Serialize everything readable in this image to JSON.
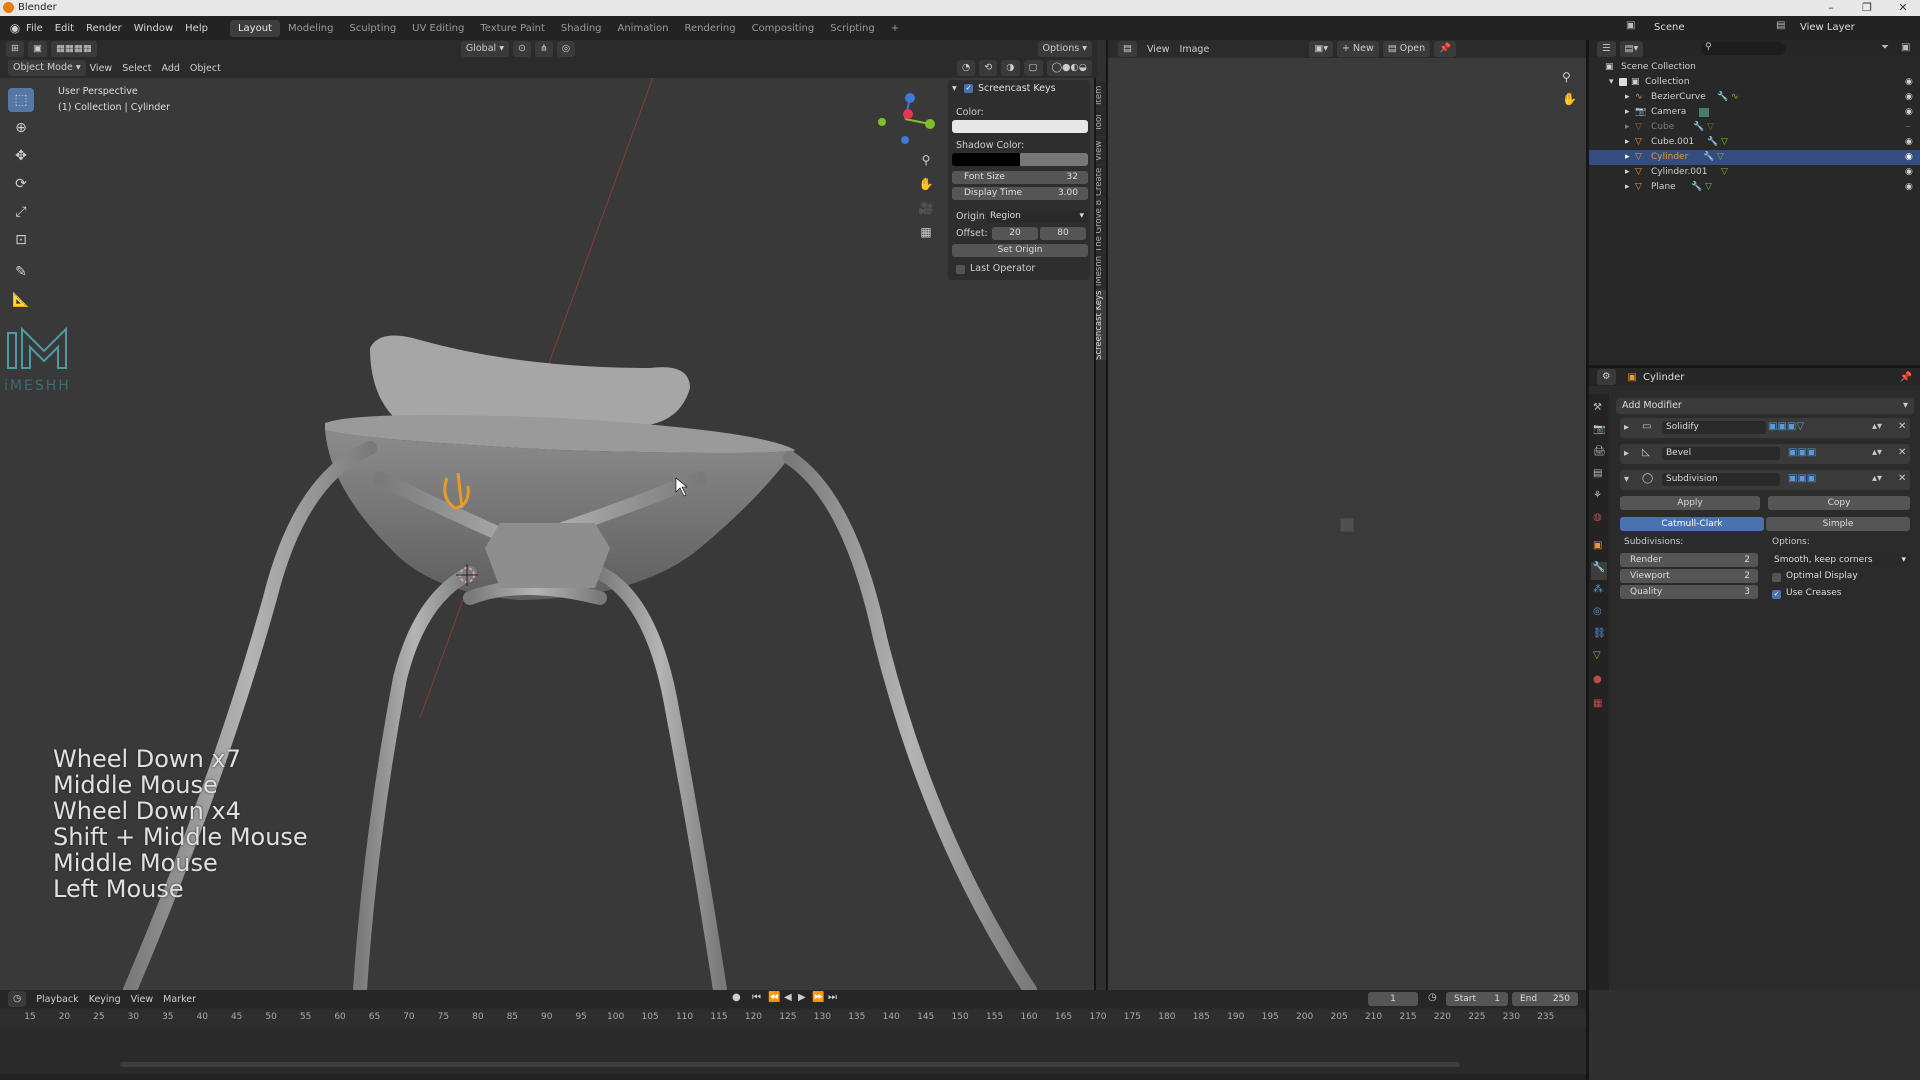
{
  "app": {
    "title": "Blender"
  },
  "menubar": {
    "items": [
      "File",
      "Edit",
      "Render",
      "Window",
      "Help"
    ],
    "workspaces": [
      "Layout",
      "Modeling",
      "Sculpting",
      "UV Editing",
      "Texture Paint",
      "Shading",
      "Animation",
      "Rendering",
      "Compositing",
      "Scripting"
    ],
    "active_workspace": "Layout",
    "scene_label": "Scene",
    "viewlayer_label": "View Layer"
  },
  "viewport_header": {
    "transform_orientation": "Global",
    "options_label": "Options",
    "mode": "Object Mode",
    "menus": [
      "View",
      "Select",
      "Add",
      "Object"
    ]
  },
  "viewport": {
    "perspective_label": "User Perspective",
    "collection_label": "(1) Collection | Cylinder",
    "logo_text": "iMESHH"
  },
  "npanel": {
    "header": "Screencast Keys",
    "color_label": "Color:",
    "shadow_color_label": "Shadow Color:",
    "font_size_label": "Font Size",
    "font_size_value": "32",
    "display_time_label": "Display Time",
    "display_time_value": "3.00",
    "origin_label": "Origin:",
    "origin_value": "Region",
    "offset_label": "Offset:",
    "offset_x": "20",
    "offset_y": "80",
    "set_origin_label": "Set Origin",
    "last_operator_label": "Last Operator",
    "tabs": [
      "Item",
      "Tool",
      "View",
      "Create",
      "The Grove 8",
      "iMeshh",
      "Screencast Keys"
    ]
  },
  "image_editor": {
    "menus": [
      "View",
      "Image"
    ],
    "new_label": "New",
    "open_label": "Open"
  },
  "outliner": {
    "root": "Scene Collection",
    "collection": "Collection",
    "items": [
      {
        "name": "BezierCurve"
      },
      {
        "name": "Camera"
      },
      {
        "name": "Cube"
      },
      {
        "name": "Cube.001"
      },
      {
        "name": "Cylinder"
      },
      {
        "name": "Cylinder.001"
      },
      {
        "name": "Plane"
      }
    ],
    "selected": "Cylinder"
  },
  "properties": {
    "object_name": "Cylinder",
    "add_modifier_label": "Add Modifier",
    "modifiers": [
      "Solidify",
      "Bevel",
      "Subdivision"
    ],
    "apply_label": "Apply",
    "copy_label": "Copy",
    "catmull_label": "Catmull-Clark",
    "simple_label": "Simple",
    "subdivisions_label": "Subdivisions:",
    "options_label": "Options:",
    "render_label": "Render",
    "render_value": "2",
    "viewport_label": "Viewport",
    "viewport_value": "2",
    "quality_label": "Quality",
    "quality_value": "3",
    "uv_smooth_value": "Smooth, keep corners",
    "optimal_display_label": "Optimal Display",
    "use_creases_label": "Use Creases"
  },
  "timeline": {
    "menus": [
      "Playback",
      "Keying",
      "View",
      "Marker"
    ],
    "current_frame": "1",
    "start_label": "Start",
    "start_value": "1",
    "end_label": "End",
    "end_value": "250",
    "ticks": [
      "15",
      "20",
      "25",
      "30",
      "35",
      "40",
      "45",
      "50",
      "55",
      "60",
      "65",
      "70",
      "75",
      "80",
      "85",
      "90",
      "95",
      "100",
      "105",
      "110",
      "115",
      "120",
      "125",
      "130",
      "135",
      "140",
      "145",
      "150",
      "155",
      "160",
      "165",
      "170",
      "175",
      "180",
      "185",
      "190",
      "195",
      "200",
      "205",
      "210",
      "215",
      "220",
      "225",
      "230",
      "235"
    ]
  },
  "screencast_keys": {
    "lines": [
      "Wheel Down x7",
      "Middle Mouse",
      "Wheel Down x4",
      "Shift + Middle Mouse",
      "Middle Mouse",
      "Left Mouse"
    ]
  },
  "colors": {
    "accent": "#5577a8",
    "selected_row": "#334d80",
    "catmull_active": "#4a72b0",
    "axis_x": "#e23a4f",
    "axis_y": "#7fbf2a",
    "axis_z": "#3e7ad6"
  }
}
